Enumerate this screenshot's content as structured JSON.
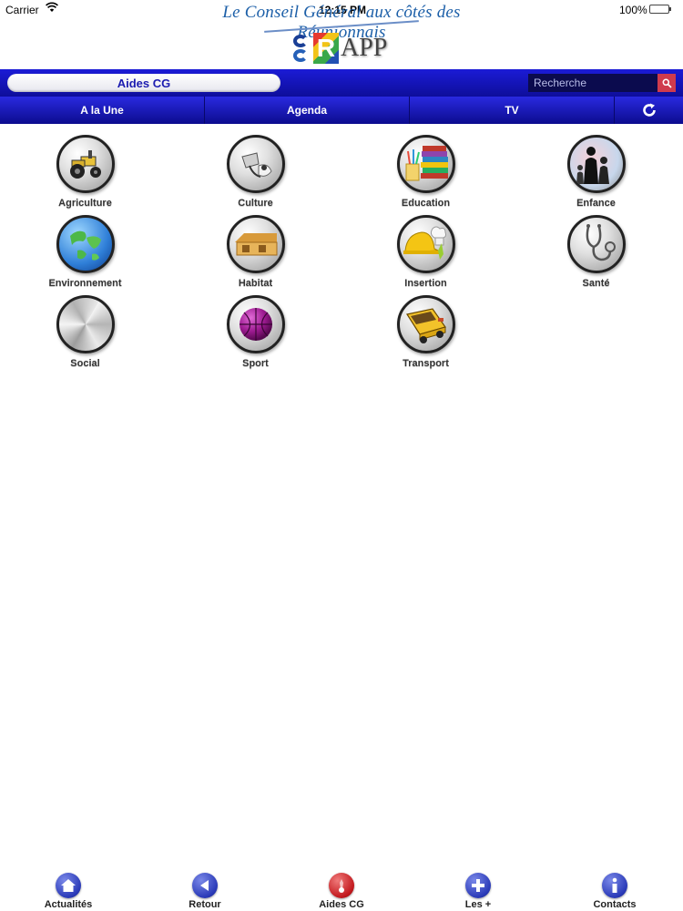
{
  "status_bar": {
    "carrier": "Carrier",
    "time": "12:15 PM",
    "battery": "100%"
  },
  "header": {
    "tagline": "Le Conseil Général aux côtés des Réunionnais",
    "logo_r": "R",
    "logo_app": "APP"
  },
  "nav": {
    "section_title": "Aides CG",
    "search_placeholder": "Recherche",
    "tabs": [
      {
        "label": "A la Une"
      },
      {
        "label": "Agenda"
      },
      {
        "label": "TV"
      }
    ]
  },
  "categories": [
    {
      "label": "Agriculture",
      "icon": "tractor-icon"
    },
    {
      "label": "Culture",
      "icon": "culture-icon"
    },
    {
      "label": "Education",
      "icon": "books-icon"
    },
    {
      "label": "Enfance",
      "icon": "family-icon"
    },
    {
      "label": "Environnement",
      "icon": "globe-icon"
    },
    {
      "label": "Habitat",
      "icon": "house-icon"
    },
    {
      "label": "Insertion",
      "icon": "hardhat-icon"
    },
    {
      "label": "Santé",
      "icon": "stethoscope-icon"
    },
    {
      "label": "Social",
      "icon": "social-icon"
    },
    {
      "label": "Sport",
      "icon": "ball-icon"
    },
    {
      "label": "Transport",
      "icon": "bus-icon"
    }
  ],
  "toolbar": [
    {
      "label": "Actualités",
      "icon": "home-icon"
    },
    {
      "label": "Retour",
      "icon": "back-arrow-icon"
    },
    {
      "label": "Aides CG",
      "icon": "aides-icon"
    },
    {
      "label": "Les +",
      "icon": "plus-icon"
    },
    {
      "label": "Contacts",
      "icon": "info-icon"
    }
  ],
  "colors": {
    "nav_blue": "#1414b0",
    "pill_text": "#1b1bb0",
    "search_button": "#cf3b4d",
    "toolbar_blue": "#2a3ab8",
    "toolbar_red": "#c2181d"
  }
}
